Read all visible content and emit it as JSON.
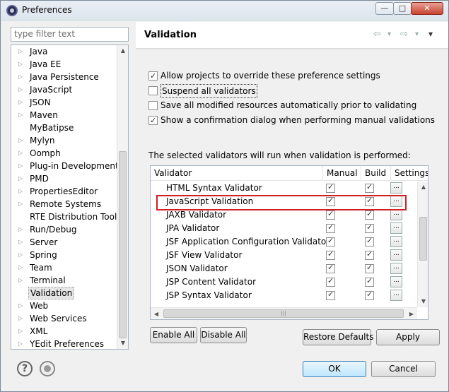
{
  "window": {
    "title": "Preferences"
  },
  "window_buttons": {
    "minimize": "—",
    "maximize": "□",
    "close": "✕"
  },
  "filter": {
    "placeholder": "type filter text"
  },
  "tree": {
    "items": [
      {
        "label": "Java",
        "expandable": true
      },
      {
        "label": "Java EE",
        "expandable": true
      },
      {
        "label": "Java Persistence",
        "expandable": true
      },
      {
        "label": "JavaScript",
        "expandable": true
      },
      {
        "label": "JSON",
        "expandable": true
      },
      {
        "label": "Maven",
        "expandable": true
      },
      {
        "label": "MyBatipse",
        "expandable": false
      },
      {
        "label": "Mylyn",
        "expandable": true
      },
      {
        "label": "Oomph",
        "expandable": true
      },
      {
        "label": "Plug-in Development",
        "expandable": true
      },
      {
        "label": "PMD",
        "expandable": true
      },
      {
        "label": "PropertiesEditor",
        "expandable": true
      },
      {
        "label": "Remote Systems",
        "expandable": true
      },
      {
        "label": "RTE Distribution Tool",
        "expandable": false
      },
      {
        "label": "Run/Debug",
        "expandable": true
      },
      {
        "label": "Server",
        "expandable": true
      },
      {
        "label": "Spring",
        "expandable": true
      },
      {
        "label": "Team",
        "expandable": true
      },
      {
        "label": "Terminal",
        "expandable": true
      },
      {
        "label": "Validation",
        "expandable": false,
        "selected": true
      },
      {
        "label": "Web",
        "expandable": true
      },
      {
        "label": "Web Services",
        "expandable": true
      },
      {
        "label": "XML",
        "expandable": true
      },
      {
        "label": "YEdit Preferences",
        "expandable": true
      }
    ]
  },
  "page": {
    "title": "Validation",
    "nav": {
      "back": "⇦",
      "back_menu": "▾",
      "forward": "⇨",
      "forward_menu": "▾",
      "view_menu": "▾"
    }
  },
  "options": [
    {
      "label": "Allow projects to override these preference settings",
      "checked": true
    },
    {
      "label": "Suspend all validators",
      "checked": false
    },
    {
      "label": "Save all modified resources automatically prior to validating",
      "checked": false
    },
    {
      "label": "Show a confirmation dialog when performing manual validations",
      "checked": true
    }
  ],
  "info_text": "The selected validators will run when validation is performed:",
  "table": {
    "columns": [
      "Validator",
      "Manual",
      "Build",
      "Settings"
    ],
    "rows": [
      {
        "name": "HTML Syntax Validator",
        "manual": true,
        "build": true
      },
      {
        "name": "JavaScript Validation",
        "manual": true,
        "build": true
      },
      {
        "name": "JAXB Validator",
        "manual": true,
        "build": true
      },
      {
        "name": "JPA Validator",
        "manual": true,
        "build": true
      },
      {
        "name": "JSF Application Configuration Validator",
        "manual": true,
        "build": true
      },
      {
        "name": "JSF View Validator",
        "manual": true,
        "build": true
      },
      {
        "name": "JSON Validator",
        "manual": true,
        "build": true
      },
      {
        "name": "JSP Content Validator",
        "manual": true,
        "build": true
      },
      {
        "name": "JSP Syntax Validator",
        "manual": true,
        "build": true
      }
    ],
    "settings_button": "..."
  },
  "buttons": {
    "enable_all": "Enable All",
    "disable_all": "Disable All",
    "restore_defaults": "Restore Defaults",
    "apply": "Apply",
    "ok": "OK",
    "cancel": "Cancel"
  },
  "colors": {
    "highlight": "#d02024",
    "default_button": "#3c7fb1"
  }
}
